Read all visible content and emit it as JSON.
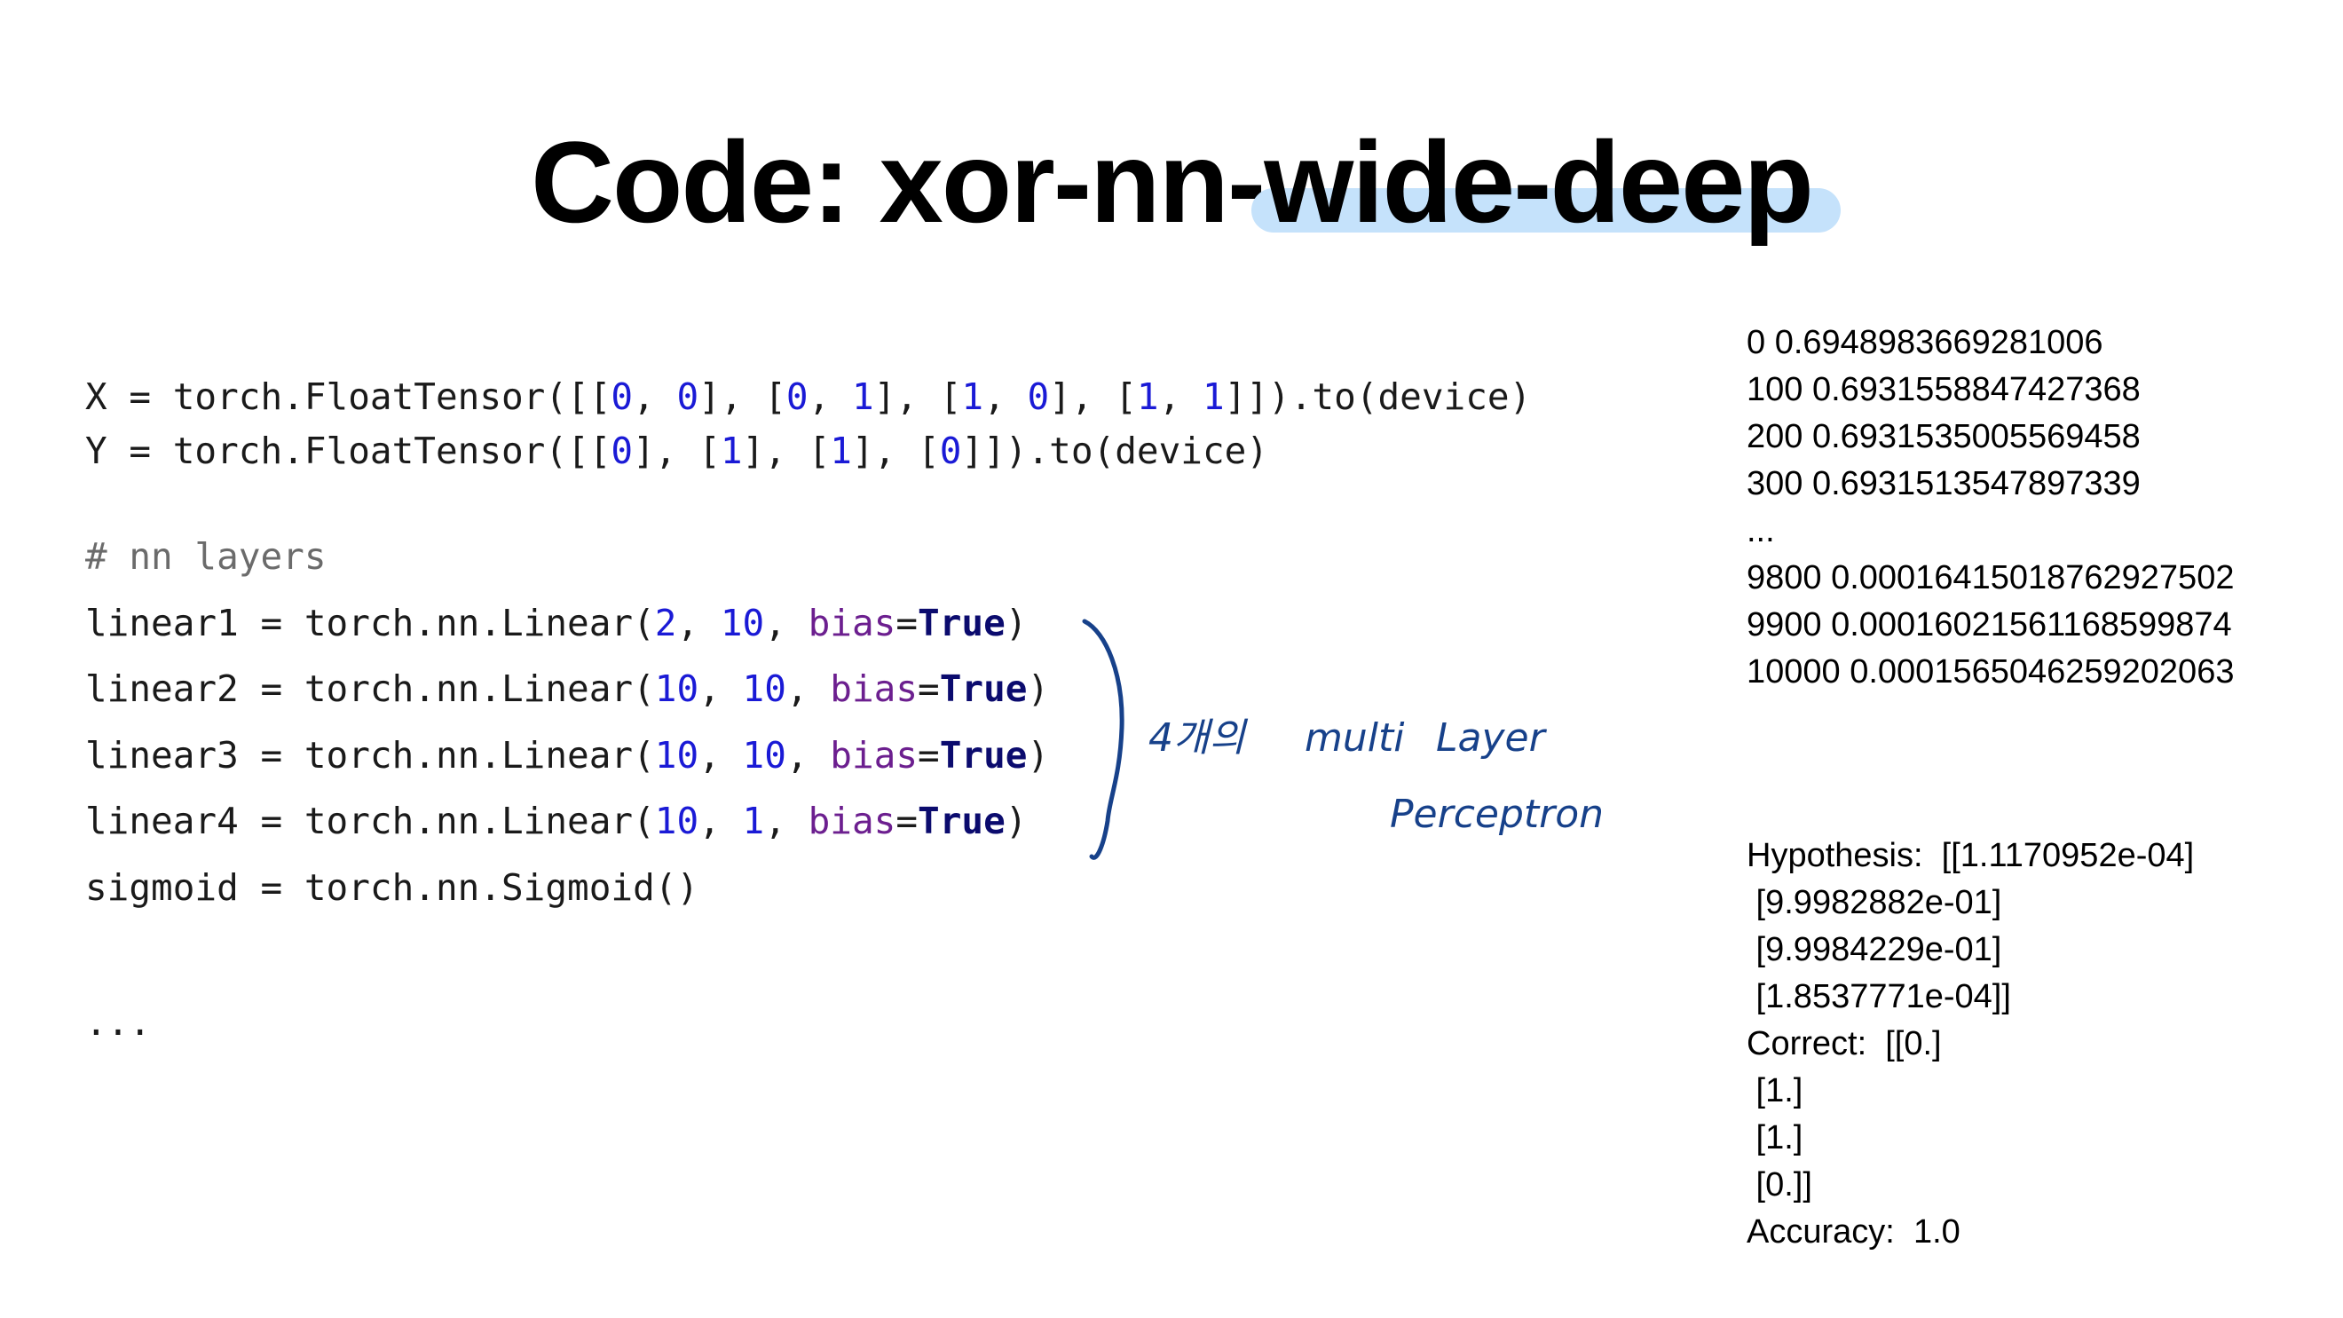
{
  "title": {
    "prefix": "Code: xor-nn-",
    "highlight": "wide-deep"
  },
  "code": {
    "x_line": {
      "pre": "X = torch.FloatTensor([[",
      "n1": "0",
      "s1": ", ",
      "n2": "0",
      "s2": "], [",
      "n3": "0",
      "s3": ", ",
      "n4": "1",
      "s4": "], [",
      "n5": "1",
      "s5": ", ",
      "n6": "0",
      "s6": "], [",
      "n7": "1",
      "s7": ", ",
      "n8": "1",
      "post": "]]).to(device)"
    },
    "y_line": {
      "pre": "Y = torch.FloatTensor([[",
      "n1": "0",
      "s1": "], [",
      "n2": "1",
      "s2": "], [",
      "n3": "1",
      "s3": "], [",
      "n4": "0",
      "post": "]]).to(device)"
    },
    "comment": "# nn layers",
    "layers": [
      {
        "pre": "linear1 = torch.nn.Linear(",
        "a": "2",
        "sep": ", ",
        "b": "10",
        "sep2": ", ",
        "kw": "bias",
        "eq": "=",
        "val": "True",
        "post": ")"
      },
      {
        "pre": "linear2 = torch.nn.Linear(",
        "a": "10",
        "sep": ", ",
        "b": "10",
        "sep2": ", ",
        "kw": "bias",
        "eq": "=",
        "val": "True",
        "post": ")"
      },
      {
        "pre": "linear3 = torch.nn.Linear(",
        "a": "10",
        "sep": ", ",
        "b": "10",
        "sep2": ", ",
        "kw": "bias",
        "eq": "=",
        "val": "True",
        "post": ")"
      },
      {
        "pre": "linear4 = torch.nn.Linear(",
        "a": "10",
        "sep": ", ",
        "b": "1",
        "sep2": ", ",
        "kw": "bias",
        "eq": "=",
        "val": "True",
        "post": ")"
      }
    ],
    "sigmoid": "sigmoid = torch.nn.Sigmoid()",
    "ellipsis": "..."
  },
  "annotation": {
    "line1_korean": "4개의",
    "line1_multi": "multi",
    "line1_layer": "Layer",
    "line2": "Perceptron",
    "ink_color": "#17418a"
  },
  "output": {
    "loss_lines": [
      "0 0.6948983669281006",
      "100 0.6931558847427368",
      "200 0.6931535005569458",
      "300 0.6931513547897339",
      "...",
      "9800 0.00016415018762927502",
      "9900 0.00016021561168599874",
      "10000 0.0001565046259202063"
    ],
    "result_lines": [
      "Hypothesis:  [[1.1170952e-04]",
      " [9.9982882e-01]",
      " [9.9984229e-01]",
      " [1.8537771e-04]]",
      "Correct:  [[0.]",
      " [1.]",
      " [1.]",
      " [0.]]",
      "Accuracy:  1.0"
    ]
  },
  "colors": {
    "highlight": "#c5e2fb",
    "number": "#1a1ad6",
    "keyword": "#6c1f8f",
    "true": "#0b0b6e",
    "comment": "#6b6b6b"
  }
}
